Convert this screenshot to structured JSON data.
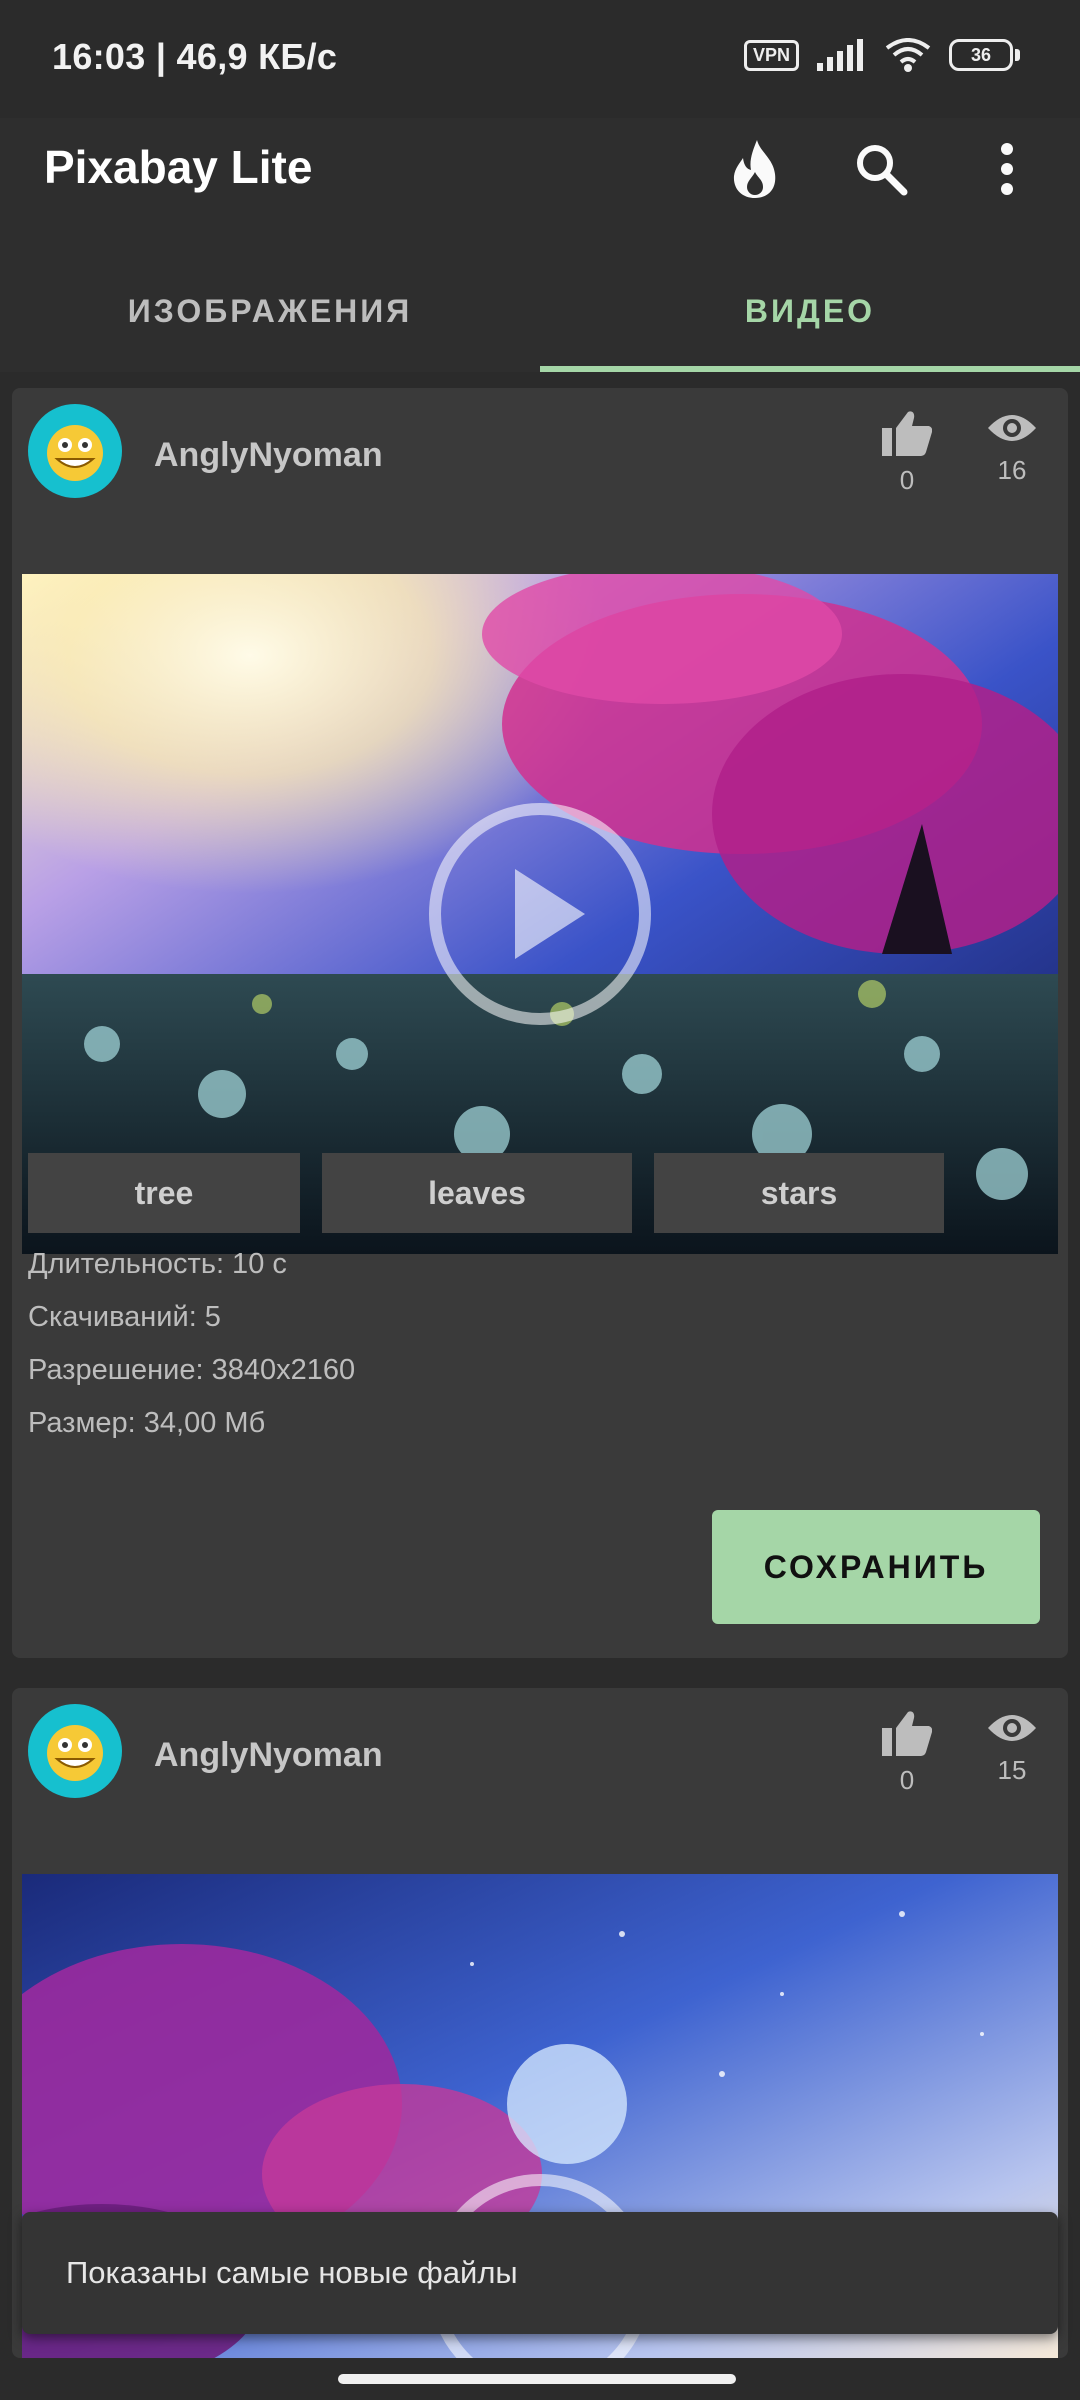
{
  "status_bar": {
    "time": "16:03 | 46,9 КБ/с",
    "vpn": "VPN",
    "battery": "36"
  },
  "app_bar": {
    "title": "Pixabay Lite",
    "icons": [
      "fire-icon",
      "search-icon",
      "more-vert-icon"
    ]
  },
  "tabs": [
    {
      "label": "ИЗОБРАЖЕНИЯ",
      "active": false
    },
    {
      "label": "ВИДЕО",
      "active": true
    }
  ],
  "cards": [
    {
      "author": "AnglyNyoman",
      "likes": "0",
      "views": "16",
      "tags": [
        "tree",
        "leaves",
        "stars"
      ],
      "duration": "Длительность: 10 с",
      "downloads": "Скачиваний: 5",
      "resolution": "Разрешение: 3840x2160",
      "size": "Размер: 34,00 Мб",
      "save_label": "СОХРАНИТЬ"
    },
    {
      "author": "AnglyNyoman",
      "likes": "0",
      "views": "15"
    }
  ],
  "snackbar": {
    "text": "Показаны самые новые файлы"
  },
  "colors": {
    "accent": "#a5d6a7",
    "background": "#2b2b2b",
    "card": "#3a3a3a"
  }
}
